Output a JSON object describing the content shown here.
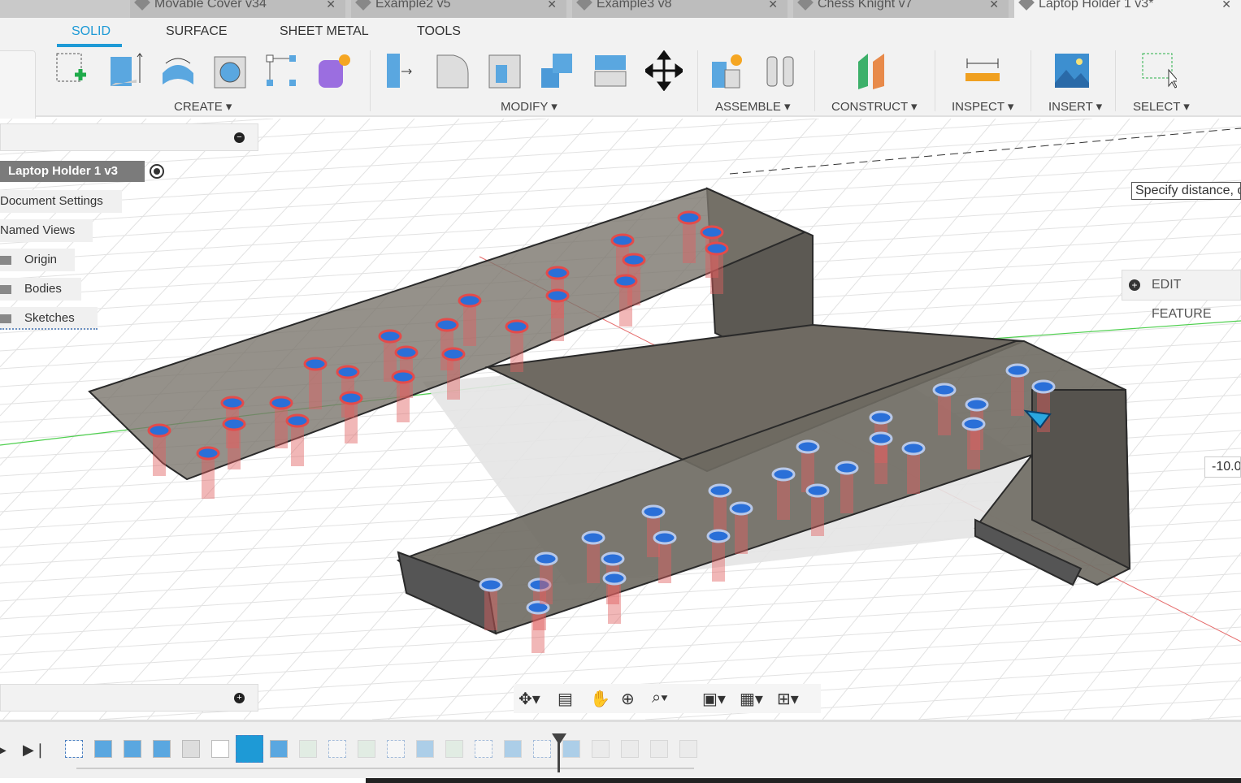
{
  "tabs": [
    {
      "label": "Movable Cover v34"
    },
    {
      "label": "Example2 v5"
    },
    {
      "label": "Example3 v8"
    },
    {
      "label": "Chess Knight v7"
    },
    {
      "label": "Laptop Holder 1 v3*",
      "active": true
    }
  ],
  "workspace_tabs": [
    "SOLID",
    "SURFACE",
    "SHEET METAL",
    "TOOLS"
  ],
  "groups": {
    "create": "CREATE ▾",
    "modify": "MODIFY ▾",
    "assemble": "ASSEMBLE ▾",
    "construct": "CONSTRUCT ▾",
    "inspect": "INSPECT ▾",
    "insert": "INSERT ▾",
    "select": "SELECT ▾"
  },
  "browser": {
    "root": "Laptop Holder 1 v3",
    "items": [
      "Document Settings",
      "Named Views",
      "Origin",
      "Bodies",
      "Sketches"
    ]
  },
  "viewport": {
    "hint": "Specify distance, o",
    "edit_feature": "EDIT FEATURE",
    "distance_value": "-10.0"
  },
  "timeline_icons": [
    "sketch",
    "extrude",
    "extrude",
    "extrude",
    "combine",
    "move",
    "sketch-active",
    "extrude",
    "plane",
    "sketch",
    "plane",
    "sketch",
    "extrude",
    "plane",
    "sketch",
    "extrude",
    "sketch",
    "extrude",
    "fillet",
    "fillet",
    "fillet",
    "fillet"
  ],
  "colors": {
    "accent": "#1e9ad6",
    "body": "#6f6a62",
    "hole_red": "#e34b4b",
    "hole_blue": "#2a6fd8"
  }
}
